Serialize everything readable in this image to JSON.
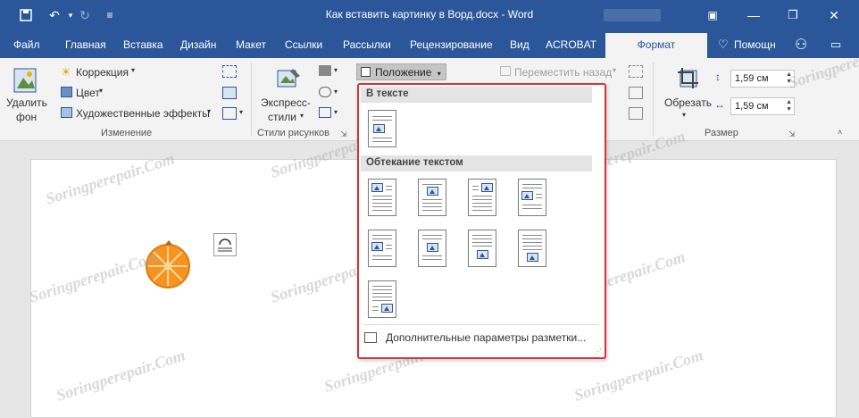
{
  "window": {
    "title": "Как вставить картинку в Ворд.docx - Word"
  },
  "tabs": [
    {
      "label": "Файл"
    },
    {
      "label": "Главная"
    },
    {
      "label": "Вставка"
    },
    {
      "label": "Дизайн"
    },
    {
      "label": "Макет"
    },
    {
      "label": "Ссылки"
    },
    {
      "label": "Рассылки"
    },
    {
      "label": "Рецензирование"
    },
    {
      "label": "Вид"
    },
    {
      "label": "ACROBAT"
    },
    {
      "label": "Формат"
    }
  ],
  "help_label": "Помощн",
  "ribbon": {
    "remove_bg": {
      "line1": "Удалить",
      "line2": "фон"
    },
    "correction": "Коррекция",
    "color": "Цвет",
    "artistic": "Художественные эффекты",
    "group_change": "Изменение",
    "express": {
      "line1": "Экспресс-",
      "line2": "стили"
    },
    "group_styles": "Стили рисунков",
    "position": "Положение",
    "move_back": "Переместить назад",
    "crop": "Обрезать",
    "height": "1,59 см",
    "width": "1,59 см",
    "group_size": "Размер"
  },
  "menu": {
    "in_text": "В тексте",
    "wrap": "Обтекание текстом",
    "more": "Дополнительные параметры разметки..."
  },
  "watermark": "Soringperepair.Com",
  "colors": {
    "accent": "#2b579a",
    "highlight_border": "#d6343a",
    "orange": "#f7931e"
  }
}
